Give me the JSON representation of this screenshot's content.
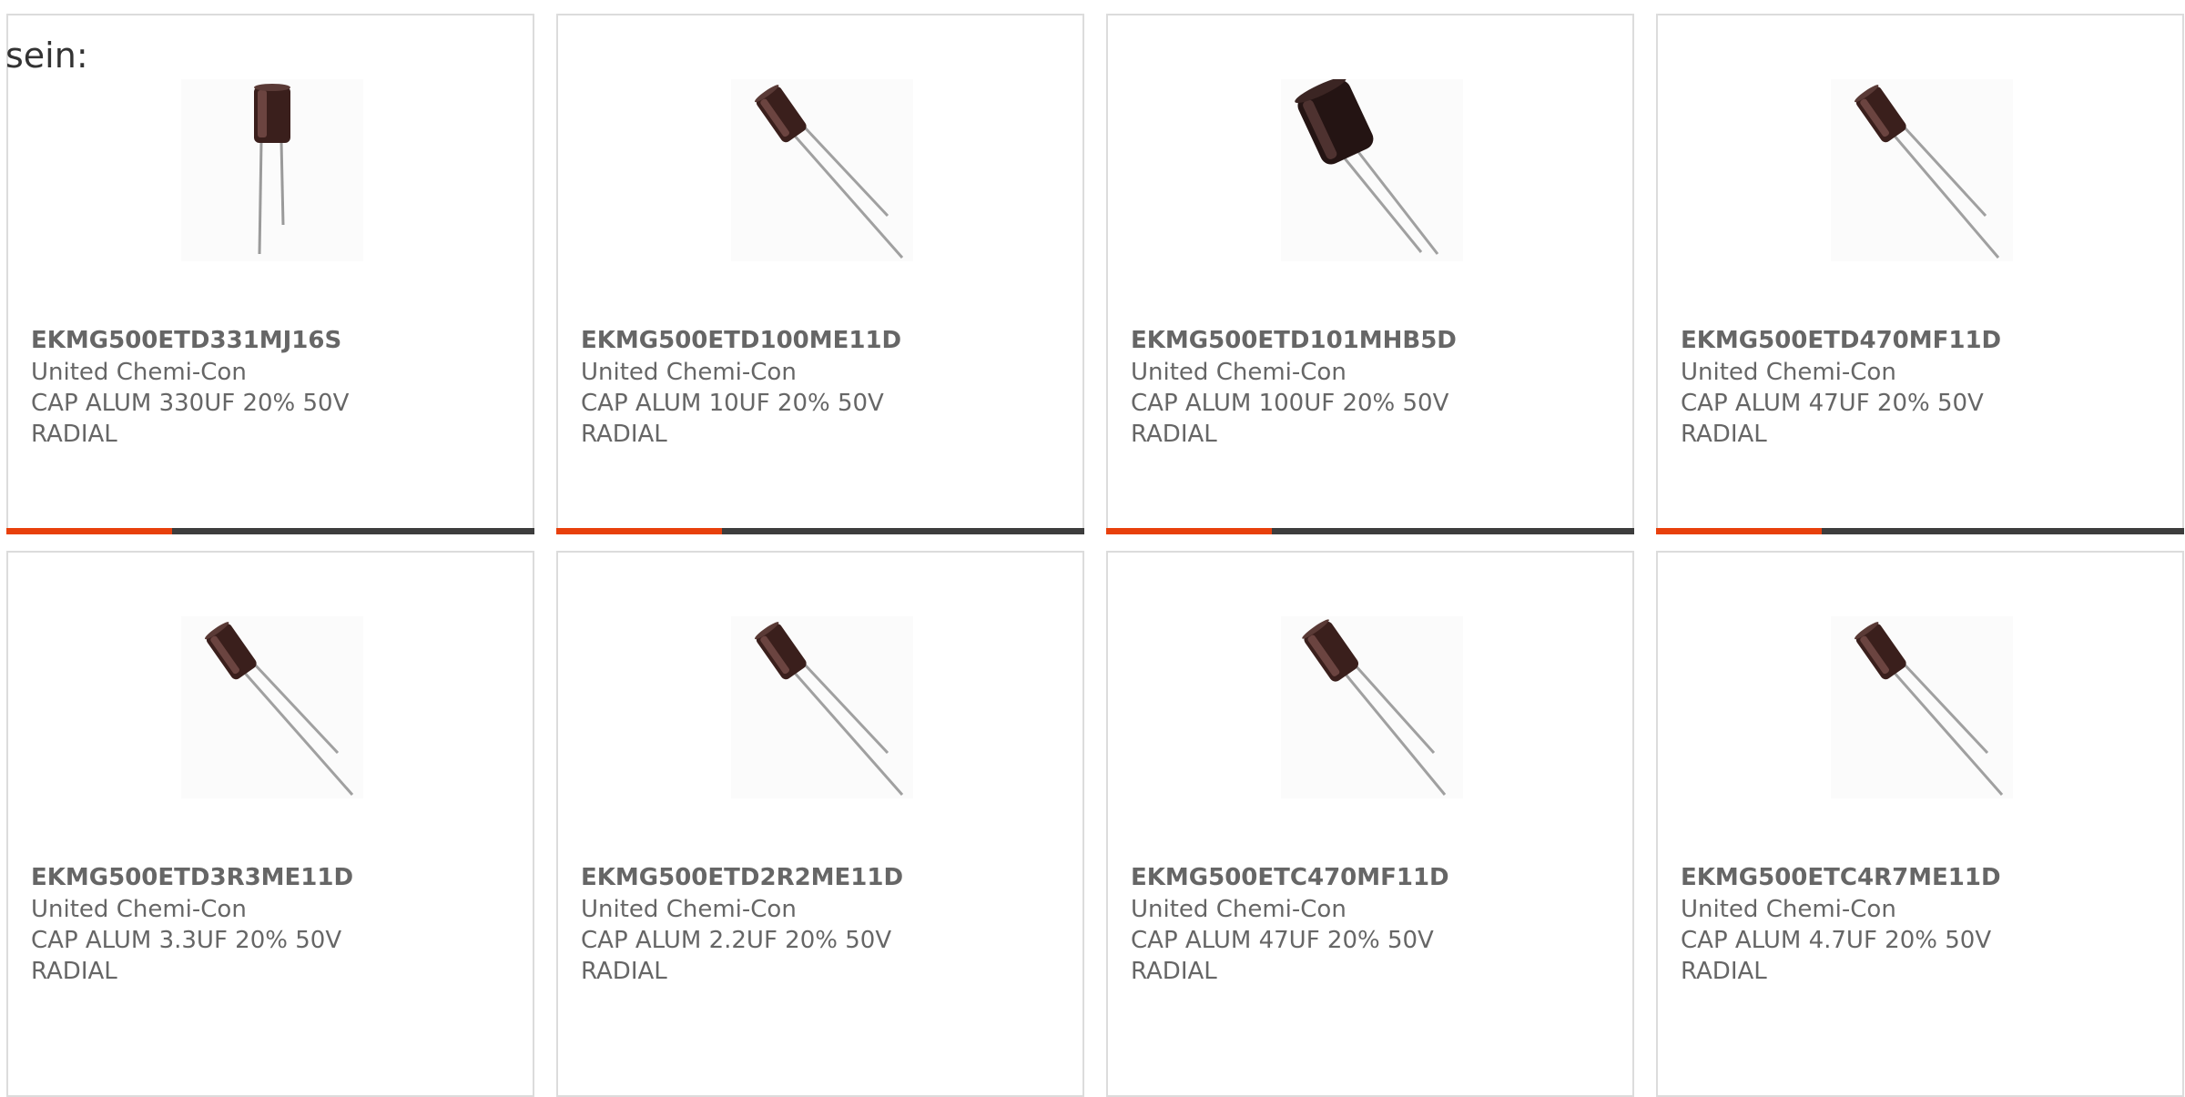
{
  "intro_text": "sein:",
  "colors": {
    "accent": "#e8400c",
    "bar": "#3d3d3d",
    "border": "#dcdcdc",
    "text": "#666666"
  },
  "products": [
    {
      "part": "EKMG500ETD331MJ16S",
      "maker": "United Chemi-Con",
      "desc": "CAP ALUM 330UF 20% 50V",
      "pkg": "RADIAL",
      "icon": "capacitor-upright-image"
    },
    {
      "part": "EKMG500ETD100ME11D",
      "maker": "United Chemi-Con",
      "desc": "CAP ALUM 10UF 20% 50V",
      "pkg": "RADIAL",
      "icon": "capacitor-tilted-image"
    },
    {
      "part": "EKMG500ETD101MHB5D",
      "maker": "United Chemi-Con",
      "desc": "CAP ALUM 100UF 20% 50V",
      "pkg": "RADIAL",
      "icon": "capacitor-large-tilted-image"
    },
    {
      "part": "EKMG500ETD470MF11D",
      "maker": "United Chemi-Con",
      "desc": "CAP ALUM 47UF 20% 50V",
      "pkg": "RADIAL",
      "icon": "capacitor-tilted-image"
    },
    {
      "part": "EKMG500ETD3R3ME11D",
      "maker": "United Chemi-Con",
      "desc": "CAP ALUM 3.3UF 20% 50V",
      "pkg": "RADIAL",
      "icon": "capacitor-tilted-image"
    },
    {
      "part": "EKMG500ETD2R2ME11D",
      "maker": "United Chemi-Con",
      "desc": "CAP ALUM 2.2UF 20% 50V",
      "pkg": "RADIAL",
      "icon": "capacitor-tilted-image"
    },
    {
      "part": "EKMG500ETC470MF11D",
      "maker": "United Chemi-Con",
      "desc": "CAP ALUM 47UF 20% 50V",
      "pkg": "RADIAL",
      "icon": "capacitor-tilted-image"
    },
    {
      "part": "EKMG500ETC4R7ME11D",
      "maker": "United Chemi-Con",
      "desc": "CAP ALUM 4.7UF 20% 50V",
      "pkg": "RADIAL",
      "icon": "capacitor-tilted-image"
    }
  ]
}
